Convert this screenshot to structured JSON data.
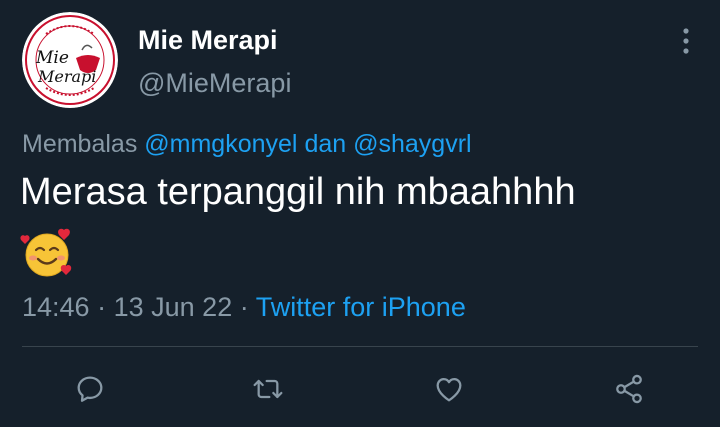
{
  "tweet": {
    "display_name": "Mie Merapi",
    "handle": "@MieMerapi",
    "avatar_text": "Mie Merapi",
    "reply_prefix": "Membalas",
    "mention1": "@mmgkonyel",
    "reply_and": "dan",
    "mention2": "@shaygvrl",
    "text": "Merasa terpanggil nih mbaahhhh",
    "emoji": "smiling-face-with-hearts",
    "time": "14:46",
    "separator": "·",
    "date": "13 Jun 22",
    "source": "Twitter for iPhone"
  },
  "actions": [
    {
      "name": "reply-icon"
    },
    {
      "name": "retweet-icon"
    },
    {
      "name": "like-icon"
    },
    {
      "name": "share-icon"
    }
  ],
  "colors": {
    "background": "#15202b",
    "text": "#ffffff",
    "muted": "#8899a6",
    "accent": "#1da1f2",
    "divider": "#38444d"
  }
}
